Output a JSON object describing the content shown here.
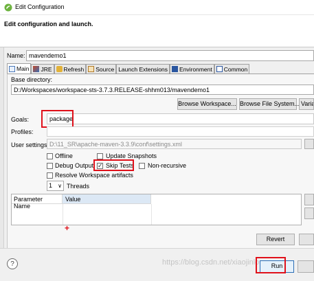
{
  "window": {
    "title": "Edit Configuration"
  },
  "header": {
    "title": "Edit configuration and launch."
  },
  "name": {
    "label": "Name:",
    "value": "mavendemo1"
  },
  "tabs": [
    {
      "label": "Main",
      "icon": "main-tab-icon"
    },
    {
      "label": "JRE",
      "icon": "jre-icon"
    },
    {
      "label": "Refresh",
      "icon": "refresh-icon"
    },
    {
      "label": "Source",
      "icon": "source-icon"
    },
    {
      "label": "Launch Extensions",
      "icon": ""
    },
    {
      "label": "Environment",
      "icon": "environment-icon"
    },
    {
      "label": "Common",
      "icon": "common-icon"
    }
  ],
  "base_directory": {
    "label": "Base directory:",
    "value": "D:/Workspaces/workspace-sts-3.7.3.RELEASE-shhm013/mavendemo1",
    "buttons": [
      "Browse Workspace...",
      "Browse File System...",
      "Varia"
    ]
  },
  "goals": {
    "label": "Goals:",
    "value": "package"
  },
  "profiles": {
    "label": "Profiles:",
    "value": ""
  },
  "user_settings": {
    "label": "User settings:",
    "value": "D:\\11_SR\\apache-maven-3.3.9\\conf\\settings.xml"
  },
  "options": {
    "offline": {
      "label": "Offline",
      "checked": false
    },
    "update_snapshots": {
      "label": "Update Snapshots",
      "checked": false
    },
    "debug_output": {
      "label": "Debug Output",
      "checked": false
    },
    "skip_tests": {
      "label": "Skip Tests",
      "checked": true
    },
    "non_recursive": {
      "label": "Non-recursive",
      "checked": false
    },
    "resolve_workspace": {
      "label": "Resolve Workspace artifacts",
      "checked": false
    }
  },
  "threads": {
    "value": "1",
    "label": "Threads"
  },
  "params_table": {
    "headers": [
      "Parameter Name",
      "Value"
    ],
    "add_marker": "+"
  },
  "buttons": {
    "revert": "Revert",
    "run": "Run"
  },
  "footer": {
    "help": "?"
  },
  "watermark": "https://blog.csdn.net/xiaojinlong",
  "colors": {
    "highlight": "#e0101a",
    "accent": "#2a6db5"
  }
}
